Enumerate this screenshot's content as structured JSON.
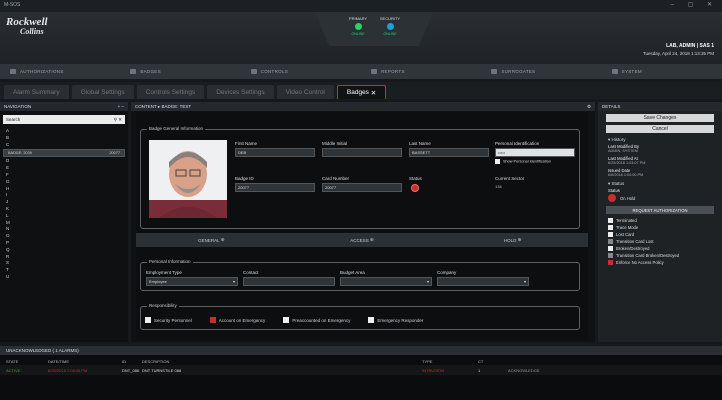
{
  "window": {
    "title": "M-SOS"
  },
  "logo": {
    "line1": "Rockwell",
    "line2": "Collins"
  },
  "servers": [
    {
      "label": "PRIMARY",
      "status": "ONLINE",
      "color": "#2fd06a"
    },
    {
      "label": "SECURITY",
      "status": "ONLINE",
      "color": "#1e9fdc"
    }
  ],
  "user": {
    "name": "LAB, ADMIN | SAS 1",
    "datetime": "Tuesday, April 24, 2018 1:13:35 PM"
  },
  "mainnav": [
    "AUTHORIZATIONS",
    "BADGES",
    "CONTROLS",
    "REPORTS",
    "SURROGATES",
    "SYSTEM"
  ],
  "subtabs": [
    "Alarm Summary",
    "Global Settings",
    "Controls Settings",
    "Devices Settings",
    "Video Control",
    "Badges"
  ],
  "navigation": {
    "title": "NAVIGATION",
    "search_placeholder": "Search",
    "tree_top": [
      "A",
      "B",
      "C"
    ],
    "selected": {
      "id": "BADGE: 2039",
      "num": "20077"
    },
    "tree_bottom": [
      "D",
      "E",
      "F",
      "G",
      "H",
      "I",
      "J",
      "K",
      "L",
      "M",
      "N",
      "O",
      "P",
      "Q",
      "R",
      "S",
      "T",
      "U"
    ]
  },
  "content": {
    "title": "CONTENT",
    "tab": "BADGE: TEST",
    "general_info": {
      "legend": "Badge General Information",
      "first_name_label": "First Name",
      "first_name": "DEB",
      "middle_initial_label": "Middle Initial",
      "middle_initial": "",
      "last_name_label": "Last Name",
      "last_name": "BASSETT",
      "pid_label": "Personal Identification",
      "pid": "•••••",
      "show_pid": "Show Personal Identification",
      "badge_id_label": "Badge ID",
      "badge_id": "20077",
      "card_number_label": "Card Number",
      "card_number": "20077",
      "status_label": "Status",
      "sector_label": "Current Sector",
      "sector": "136"
    },
    "sections": [
      "GENERAL",
      "ACCESS",
      "HOLD"
    ],
    "personal_info": {
      "legend": "Personal Information",
      "employment_label": "Employment Type",
      "employment": "Employee",
      "contact_label": "Contact",
      "contact": "",
      "budget_label": "Budget Area",
      "budget": "",
      "company_label": "Company",
      "company": ""
    },
    "responsibility": {
      "legend": "Responsibility",
      "items": [
        {
          "label": "Security Personnel",
          "checked": false
        },
        {
          "label": "Account on Emergency",
          "checked": true
        },
        {
          "label": "Preaccounted on Emergency",
          "checked": false
        },
        {
          "label": "Emergency Responder",
          "checked": false
        }
      ]
    }
  },
  "details": {
    "title": "DETAILS",
    "save_label": "Save Changes",
    "cancel_label": "Cancel",
    "history_label": "History",
    "modified_by_label": "Last Modified By",
    "modified_by": "ADMIN, SYSTEM",
    "modified_at_label": "Last Modified At",
    "modified_at": "6/25/2018 1:03:07 PM",
    "issued_label": "Issued Date",
    "issued": "6/6/2018 1:00:00 PM",
    "status_section": "Status",
    "status_label": "Status",
    "status": "On Hold",
    "request_label": "REQUEST AUTHORIZATION",
    "checks": [
      {
        "label": "Terminated",
        "state": "on"
      },
      {
        "label": "Trace Mode",
        "state": "on"
      },
      {
        "label": "Lost Card",
        "state": "on"
      },
      {
        "label": "Transition Card Lost",
        "state": "gray"
      },
      {
        "label": "Broken/Destroyed",
        "state": "on"
      },
      {
        "label": "Transition Card Broken/Destroyed",
        "state": "gray"
      },
      {
        "label": "Enforce No Access Policy",
        "state": "red"
      }
    ]
  },
  "alarms": {
    "title": "UNACKNOWLEDGED ( 1 ALARMS)",
    "columns": [
      "STATE",
      "DATE/TIME",
      "ID",
      "DESCRIPTION",
      "TYPE",
      "CT",
      ""
    ],
    "row": [
      "ACTIVE",
      "6/25/2018 1:08:45 PM",
      "DNT_086",
      "DNT TURNSTILE 086",
      "INTRUSION",
      "1",
      "ACKNOWLEDGE"
    ],
    "row_colors": [
      "#2fa84f",
      "#c6302c",
      "#ddd",
      "#ddd",
      "#c6302c",
      "#ddd",
      "#999"
    ]
  },
  "colors": {
    "accent": "#c6302c",
    "online": "#2fd06a"
  }
}
